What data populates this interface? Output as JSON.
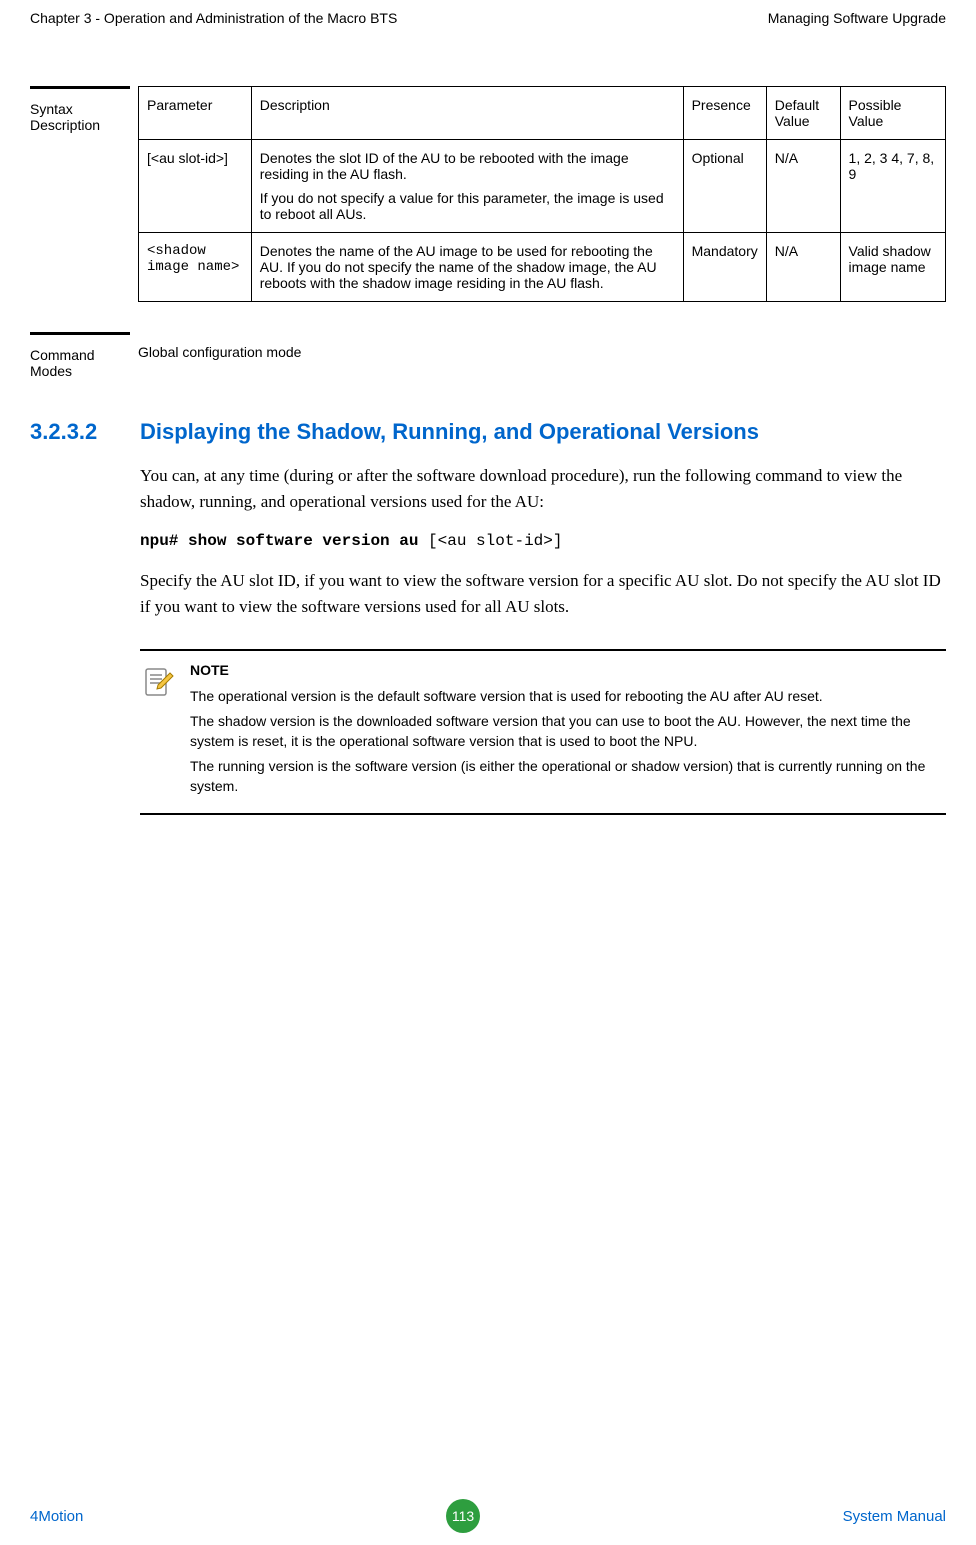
{
  "header": {
    "left": "Chapter 3 - Operation and Administration of the Macro BTS",
    "right": "Managing Software Upgrade"
  },
  "syntax_description": {
    "label": "Syntax Description",
    "headers": {
      "parameter": "Parameter",
      "description": "Description",
      "presence": "Presence",
      "default_value": "Default Value",
      "possible_value": "Possible Value"
    },
    "rows": [
      {
        "parameter": "[<au slot-id>]",
        "description_1": "Denotes the slot ID of the AU to be rebooted with the image residing in the AU flash.",
        "description_2": "If you do not specify a value for this parameter, the image is used to reboot all AUs.",
        "presence": "Optional",
        "default_value": "N/A",
        "possible_value": "1, 2, 3 4, 7, 8, 9"
      },
      {
        "parameter": "<shadow image name>",
        "description_1": "Denotes the name of the AU image to be used for rebooting the AU. If you do not specify the name of the shadow image, the AU reboots with the shadow image residing in the AU flash.",
        "description_2": "",
        "presence": "Mandatory",
        "default_value": "N/A",
        "possible_value": "Valid shadow image name"
      }
    ]
  },
  "command_modes": {
    "label": "Command Modes",
    "value": "Global configuration mode"
  },
  "heading": {
    "number": "3.2.3.2",
    "title": "Displaying the Shadow, Running, and Operational Versions"
  },
  "paragraphs": {
    "p1": "You can, at any time (during or after the software download procedure), run the following command to view the shadow, running, and operational versions used for the AU:",
    "command_bold": "npu# show software version au ",
    "command_rest": "[<au slot-id>]",
    "p2": "Specify the AU slot ID, if you want to view the software version for a specific AU slot. Do not specify the AU slot ID if you want to view the software versions used for all AU slots."
  },
  "note": {
    "label": "NOTE",
    "p1": "The operational version is the default software version that is used for rebooting the AU after AU reset.",
    "p2": "The shadow version is the downloaded software version that you can use to boot the AU. However, the next time the system is reset, it is the operational software version that is used to boot the NPU.",
    "p3": "The running version is the software version (is either the operational or shadow version) that is currently running on the system."
  },
  "footer": {
    "left": "4Motion",
    "page": "113",
    "right": "System Manual"
  }
}
